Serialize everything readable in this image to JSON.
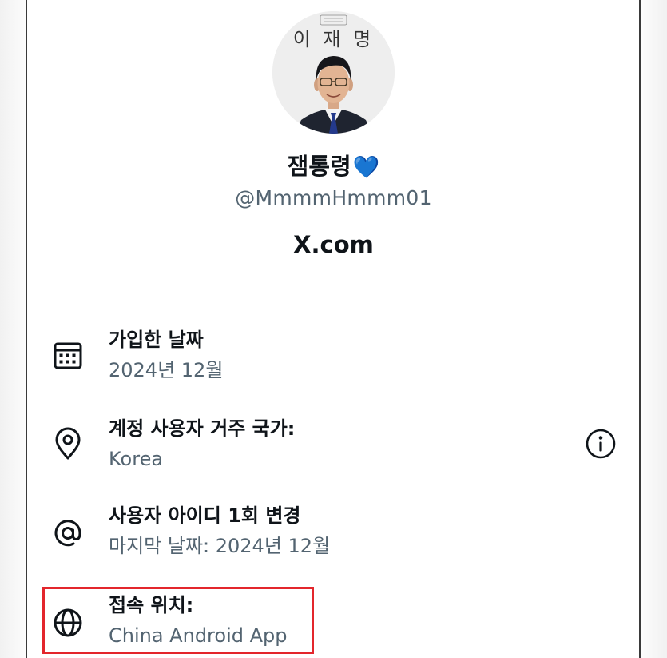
{
  "profile": {
    "avatar_text": "이 재 명",
    "display_name": "잼통령",
    "heart": "💙",
    "handle": "@MmmmHmmm01",
    "site": "X.com"
  },
  "details": [
    {
      "icon": "calendar-icon",
      "title": "가입한 날짜",
      "value": "2024년 12월"
    },
    {
      "icon": "location-pin-icon",
      "title": "계정 사용자 거주 국가:",
      "value": "Korea"
    },
    {
      "icon": "at-sign-icon",
      "title": "사용자 아이디 1회 변경",
      "value": "마지막 날짜: 2024년 12월"
    },
    {
      "icon": "globe-icon",
      "title": "접속 위치:",
      "value": "China Android App"
    }
  ],
  "info_icon": "info-icon",
  "colors": {
    "text_primary": "#0f1419",
    "text_secondary": "#536471",
    "highlight_border": "#e3262c",
    "heart": "#1d6bd8"
  }
}
